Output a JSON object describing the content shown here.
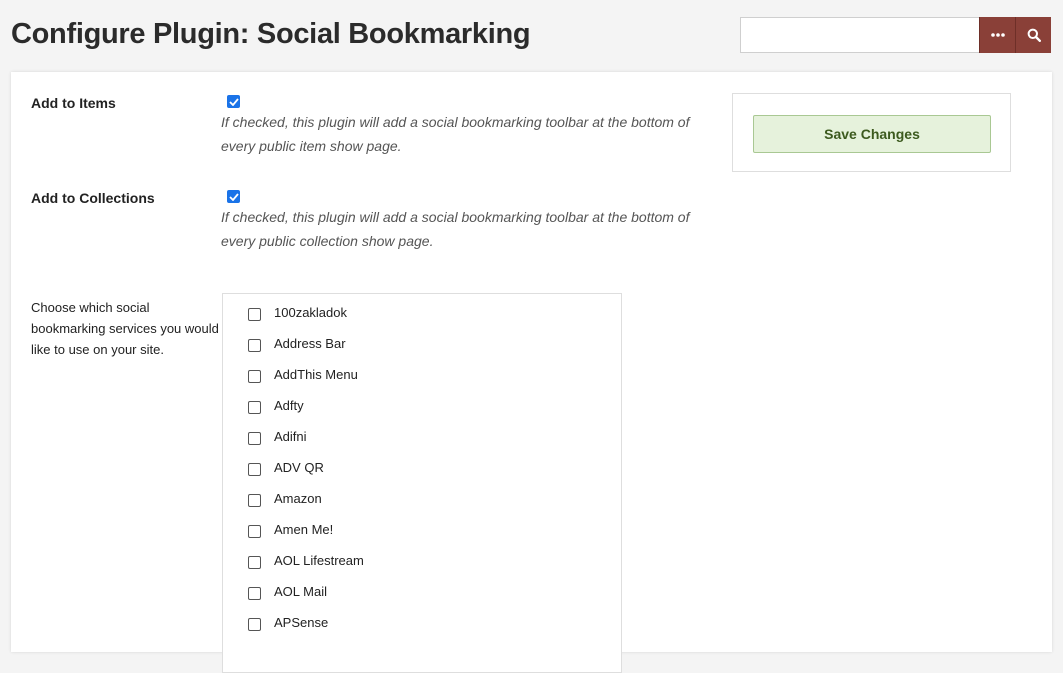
{
  "header": {
    "title": "Configure Plugin: Social Bookmarking",
    "search": {
      "value": "",
      "placeholder": "",
      "options_icon": "ellipsis-icon",
      "submit_icon": "search-icon"
    }
  },
  "form": {
    "add_to_items": {
      "label": "Add to Items",
      "checked": true,
      "explanation": "If checked, this plugin will add a social bookmarking toolbar at the bottom of every public item show page."
    },
    "add_to_collections": {
      "label": "Add to Collections",
      "checked": true,
      "explanation": "If checked, this plugin will add a social bookmarking toolbar at the bottom of every public collection show page."
    },
    "services": {
      "label": "Choose which social bookmarking services you would like to use on your site.",
      "items": [
        {
          "label": "100zakladok",
          "checked": false
        },
        {
          "label": "Address Bar",
          "checked": false
        },
        {
          "label": "AddThis Menu",
          "checked": false
        },
        {
          "label": "Adfty",
          "checked": false
        },
        {
          "label": "Adifni",
          "checked": false
        },
        {
          "label": "ADV QR",
          "checked": false
        },
        {
          "label": "Amazon",
          "checked": false
        },
        {
          "label": "Amen Me!",
          "checked": false
        },
        {
          "label": "AOL Lifestream",
          "checked": false
        },
        {
          "label": "AOL Mail",
          "checked": false
        },
        {
          "label": "APSense",
          "checked": false
        }
      ]
    }
  },
  "sidebar": {
    "save_label": "Save Changes"
  },
  "colors": {
    "accent": "#8a4038",
    "save_bg": "#e6f2dc",
    "save_text": "#3c5a1e",
    "checkbox_checked": "#1a73e8"
  }
}
